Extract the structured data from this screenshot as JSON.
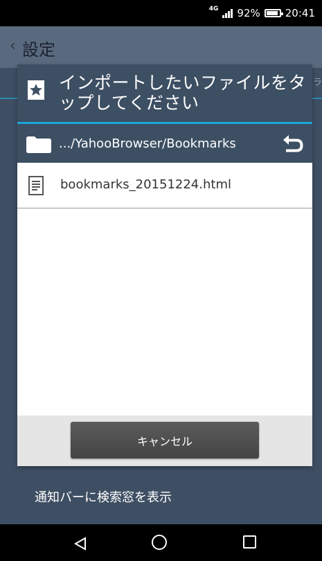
{
  "status_bar": {
    "network": "4G",
    "battery_percent": "92%",
    "time": "20:41"
  },
  "app": {
    "title": "設定",
    "tab_fragment": "ラ",
    "setting_row": "通知バーに検索窓を表示"
  },
  "dialog": {
    "title": "インポートしたいファイルをタップしてください",
    "path": ".../YahooBrowser/Bookmarks",
    "files": [
      "bookmarks_20151224.html"
    ],
    "cancel_label": "キャンセル"
  },
  "colors": {
    "header": "#3d4f63",
    "accent": "#1aa6d8",
    "button": "#4c4c4c"
  },
  "icons": [
    "bookmark-star-icon",
    "folder-icon",
    "up-arrow-icon",
    "file-icon",
    "nav-back-icon",
    "nav-home-icon",
    "nav-recent-icon"
  ]
}
